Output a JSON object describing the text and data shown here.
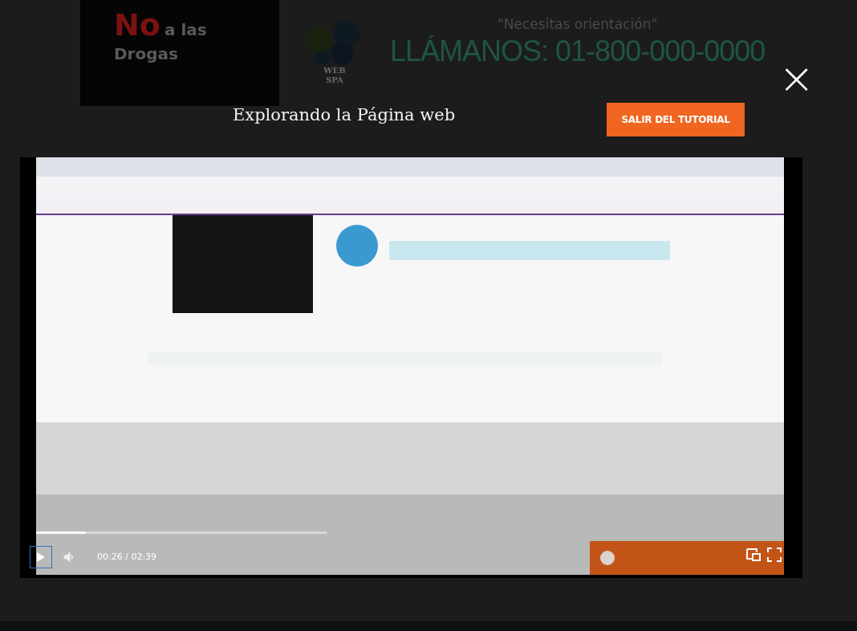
{
  "background_page": {
    "logo": {
      "word_no": "No",
      "word_alas": "a las",
      "word_drogas": "Drogas",
      "badge_line1": "WEB",
      "badge_line2": "SPA"
    },
    "tagline": "\"Necesitas orientación\"",
    "phone": "LLÁMANOS: 01-800-000-0000"
  },
  "tutorial": {
    "title": "Explorando la Página web",
    "exit_button": "SALIR DEL TUTORIAL",
    "close_label": "×",
    "video": {
      "kind": "picture",
      "player": {
        "playing": false,
        "time": "00:26 / 02:39",
        "level": 0.17
      }
    }
  }
}
